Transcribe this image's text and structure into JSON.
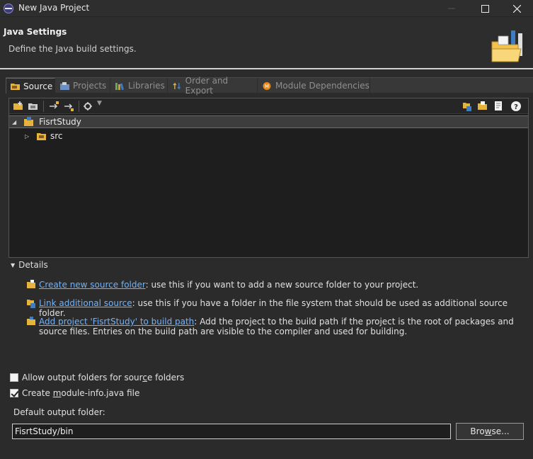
{
  "window": {
    "title": "New Java Project"
  },
  "header": {
    "title": "Java Settings",
    "description": "Define the Java build settings."
  },
  "tabs": [
    {
      "label": "Source",
      "icon": "source-folder-icon",
      "active": true
    },
    {
      "label": "Projects",
      "icon": "projects-icon",
      "active": false
    },
    {
      "label": "Libraries",
      "icon": "libraries-icon",
      "active": false
    },
    {
      "label": "Order and Export",
      "icon": "order-export-icon",
      "active": false
    },
    {
      "label": "Module Dependencies",
      "icon": "module-icon",
      "active": false
    }
  ],
  "tree": [
    {
      "label": "FisrtStudy",
      "expanded": true,
      "level": 0,
      "selected": true
    },
    {
      "label": "src",
      "expanded": false,
      "level": 1,
      "selected": false
    }
  ],
  "details": {
    "label": "Details",
    "items": [
      {
        "link": "Create new source folder",
        "text": ": use this if you want to add a new source folder to your project."
      },
      {
        "link": "Link additional source",
        "text": ": use this if you have a folder in the file system that should be used as additional source folder."
      },
      {
        "link": "Add project 'FisrtStudy' to build path",
        "text": ": Add the project to the build path if the project is the root of packages and source files. Entries on the build path are visible to the compiler and used for building."
      }
    ]
  },
  "options": {
    "allow_output": {
      "pre": "Allow output folders for sour",
      "mnemonic": "c",
      "post": "e folders",
      "checked": false
    },
    "create_module": {
      "pre": "Create ",
      "mnemonic": "m",
      "post": "odule-info.java file",
      "checked": true
    }
  },
  "output": {
    "label": "Default output folder:",
    "value": "FisrtStudy/bin",
    "browse_pre": "Bro",
    "browse_mnemonic": "w",
    "browse_post": "se..."
  }
}
